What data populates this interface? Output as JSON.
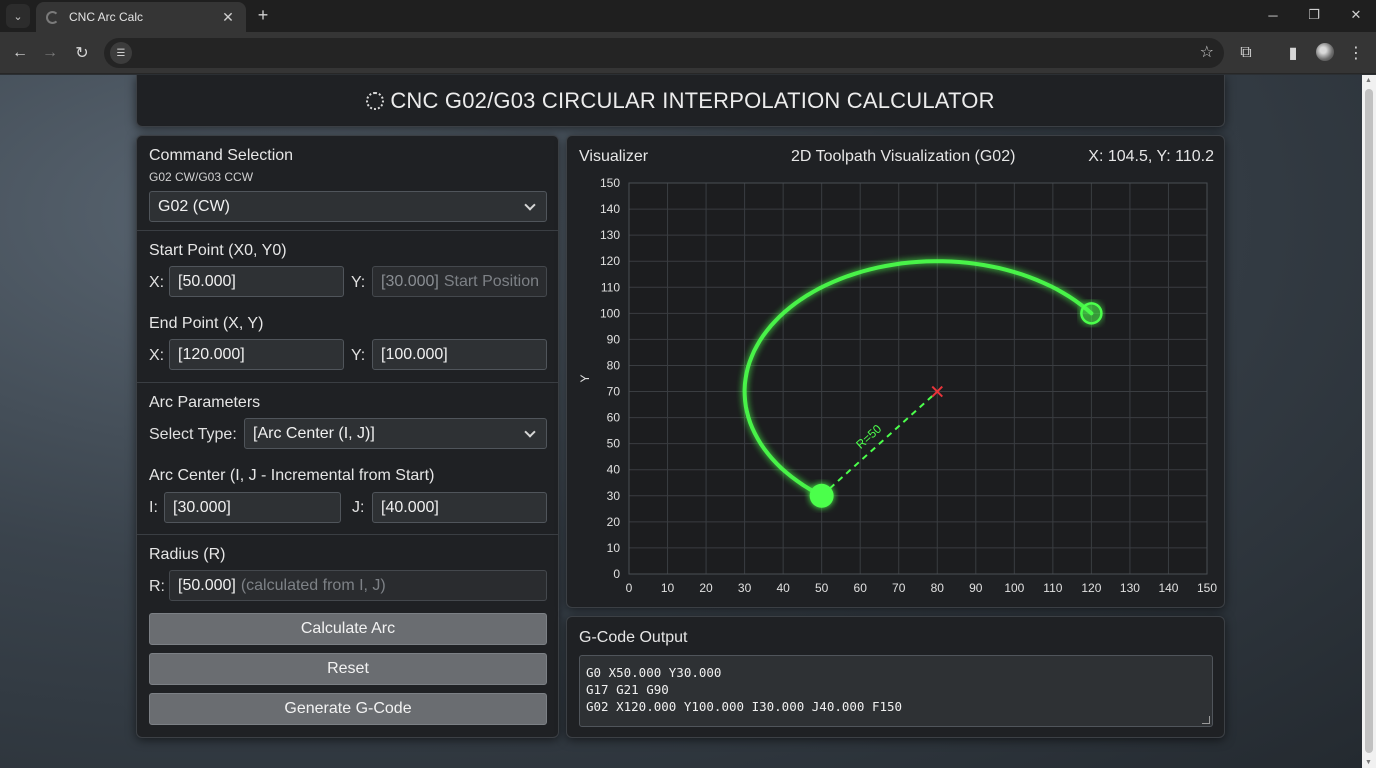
{
  "browser": {
    "tab_title": "CNC Arc Calc",
    "tab_close": "✕",
    "new_tab": "+"
  },
  "header": {
    "title": "CNC G02/G03 CIRCULAR INTERPOLATION CALCULATOR"
  },
  "command": {
    "title": "Command Selection",
    "subtitle": "G02 CW/G03 CCW",
    "selected": "G02 (CW)"
  },
  "start_point": {
    "title": "Start Point (X0, Y0)",
    "x_label": "X:",
    "x_value": "[50.000]",
    "y_label": "Y:",
    "y_value": "[30.000]",
    "y_placeholder": "Start Position"
  },
  "end_point": {
    "title": "End Point (X, Y)",
    "x_label": "X:",
    "x_value": "[120.000]",
    "y_label": "Y:",
    "y_value": "[100.000]"
  },
  "arc_params": {
    "title": "Arc Parameters",
    "type_label": "Select Type:",
    "type_selected": "[Arc Center (I, J)]"
  },
  "arc_center": {
    "title": "Arc Center (I, J - Incremental from Start)",
    "i_label": "I:",
    "i_value": "[30.000]",
    "j_label": "J:",
    "j_value": "[40.000]"
  },
  "radius": {
    "title": "Radius (R)",
    "r_label": "R:",
    "r_value": "[50.000]",
    "r_note": "(calculated from I, J)"
  },
  "buttons": {
    "calculate": "Calculate Arc",
    "reset": "Reset",
    "generate": "Generate G-Code"
  },
  "visualizer": {
    "label": "Visualizer",
    "title": "2D Toolpath Visualization (G02)",
    "cursor": "X: 104.5, Y: 110.2"
  },
  "chart_data": {
    "type": "line",
    "xlim": [
      0,
      150
    ],
    "ylim": [
      0,
      150
    ],
    "xticks": [
      0,
      10,
      20,
      30,
      40,
      50,
      60,
      70,
      80,
      90,
      100,
      110,
      120,
      130,
      140,
      150
    ],
    "yticks": [
      0,
      10,
      20,
      30,
      40,
      50,
      60,
      70,
      80,
      90,
      100,
      110,
      120,
      130,
      140,
      150
    ],
    "xlabel": "",
    "ylabel": "Y",
    "grid": true,
    "arc": {
      "start": [
        50,
        30
      ],
      "end": [
        120,
        100
      ],
      "center": [
        80,
        70
      ],
      "radius": 50,
      "direction": "CW"
    },
    "radius_label": "R=50",
    "colors": {
      "toolpath": "#4cff4c",
      "center": "#e8343a",
      "grid": "#3a3d41",
      "background": "#1c1d1f"
    }
  },
  "gcode": {
    "title": "G-Code Output",
    "lines": [
      "G0 X50.000 Y30.000",
      "G17 G21 G90",
      "G02 X120.000 Y100.000 I30.000 J40.000 F150"
    ]
  }
}
